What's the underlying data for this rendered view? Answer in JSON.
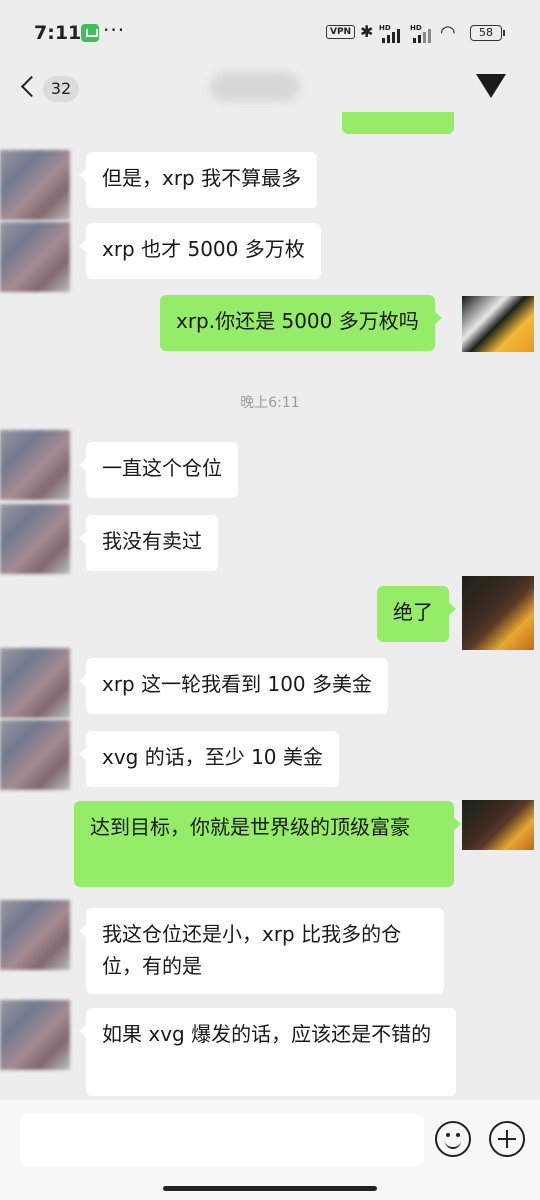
{
  "status_bar": {
    "time": "7:11",
    "dots": "···",
    "vpn": "VPN",
    "hd": "HD",
    "battery": "58"
  },
  "nav": {
    "unread_count": "32"
  },
  "chat": {
    "timestamp": "晚上6:11",
    "messages": [
      {
        "side": "in",
        "text": "但是，xrp 我不算最多"
      },
      {
        "side": "in",
        "text": "xrp 也才 5000 多万枚"
      },
      {
        "side": "out",
        "text": "xrp.你还是 5000 多万枚吗"
      },
      {
        "side": "in",
        "text": "一直这个仓位"
      },
      {
        "side": "in",
        "text": "我没有卖过"
      },
      {
        "side": "out",
        "text": "绝了"
      },
      {
        "side": "in",
        "text": "xrp 这一轮我看到 100 多美金"
      },
      {
        "side": "in",
        "text": "xvg 的话，至少 10 美金"
      },
      {
        "side": "out",
        "text": "达到目标，你就是世界级的顶级富豪"
      },
      {
        "side": "in",
        "text": "我这仓位还是小，xrp 比我多的仓位，有的是"
      },
      {
        "side": "in",
        "text": "如果 xvg 爆发的话，应该还是不错的"
      }
    ]
  },
  "colors": {
    "background": "#ededed",
    "incoming_bubble": "#ffffff",
    "outgoing_bubble": "#95ec69"
  }
}
